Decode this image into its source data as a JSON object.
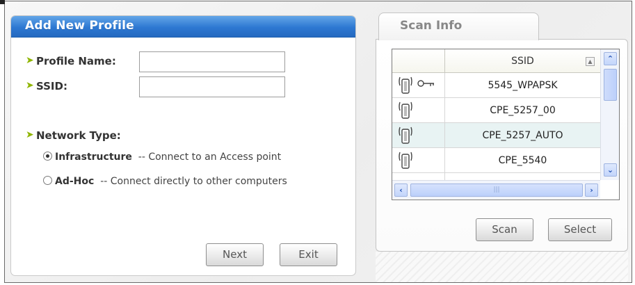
{
  "add_profile": {
    "title": "Add New Profile",
    "profile_name_label": "Profile Name:",
    "profile_name_value": "",
    "ssid_label": "SSID:",
    "ssid_value": "",
    "network_type_label": "Network Type:",
    "options": [
      {
        "name": "Infrastructure",
        "desc": "-- Connect to an Access point",
        "selected": true
      },
      {
        "name": "Ad-Hoc",
        "desc": "-- Connect directly to other computers",
        "selected": false
      }
    ],
    "next_label": "Next",
    "exit_label": "Exit"
  },
  "scan_info": {
    "tab_label": "Scan Info",
    "column_header": "SSID",
    "rows": [
      {
        "ssid": "5545_WPAPSK",
        "icon": "signal-antenna-icon",
        "secured": true,
        "highlight": false
      },
      {
        "ssid": "CPE_5257_00",
        "icon": "signal-antenna-icon",
        "secured": false,
        "highlight": false
      },
      {
        "ssid": "CPE_5257_AUTO",
        "icon": "signal-antenna-icon",
        "secured": false,
        "highlight": true
      },
      {
        "ssid": "CPE_5540",
        "icon": "signal-antenna-icon",
        "secured": false,
        "highlight": false
      }
    ],
    "scan_label": "Scan",
    "select_label": "Select"
  },
  "colors": {
    "header_blue": "#2d78d2",
    "arrow_green": "#8fb500",
    "highlight_row": "#e8f3f3"
  }
}
